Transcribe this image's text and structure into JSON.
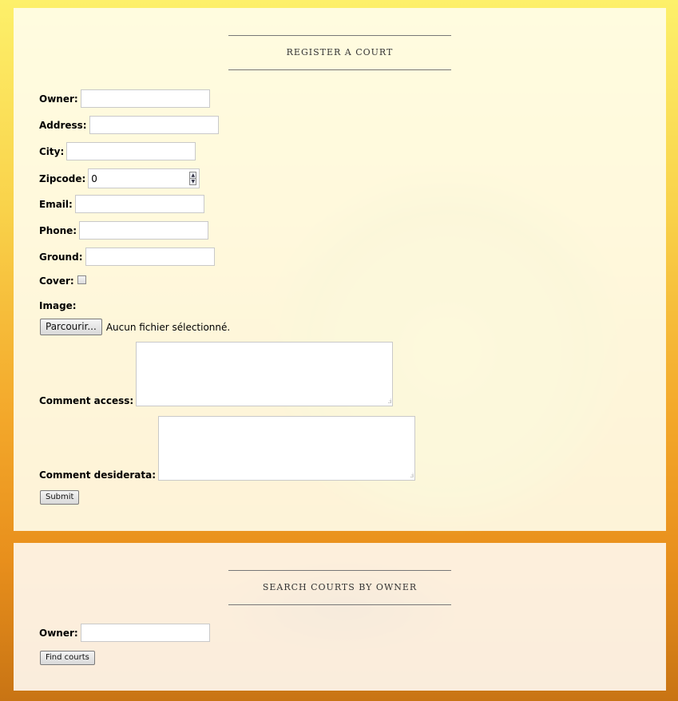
{
  "register": {
    "title": "REGISTER A COURT",
    "owner_label": "Owner:",
    "address_label": "Address:",
    "city_label": "City:",
    "zipcode_label": "Zipcode:",
    "zipcode_value": "0",
    "email_label": "Email:",
    "phone_label": "Phone:",
    "ground_label": "Ground:",
    "cover_label": "Cover:",
    "cover_checked": false,
    "image_label": "Image:",
    "browse_label": "Parcourir...",
    "file_status": "Aucun fichier sélectionné.",
    "comment_access_label": "Comment access:",
    "comment_desiderata_label": "Comment desiderata:",
    "submit_label": "Submit"
  },
  "search": {
    "title": "SEARCH COURTS BY OWNER",
    "owner_label": "Owner:",
    "find_label": "Find courts"
  },
  "icons": {
    "spin_up": "spin-up-icon",
    "spin_down": "spin-down-icon",
    "resize_grip": "resize-grip-icon"
  }
}
